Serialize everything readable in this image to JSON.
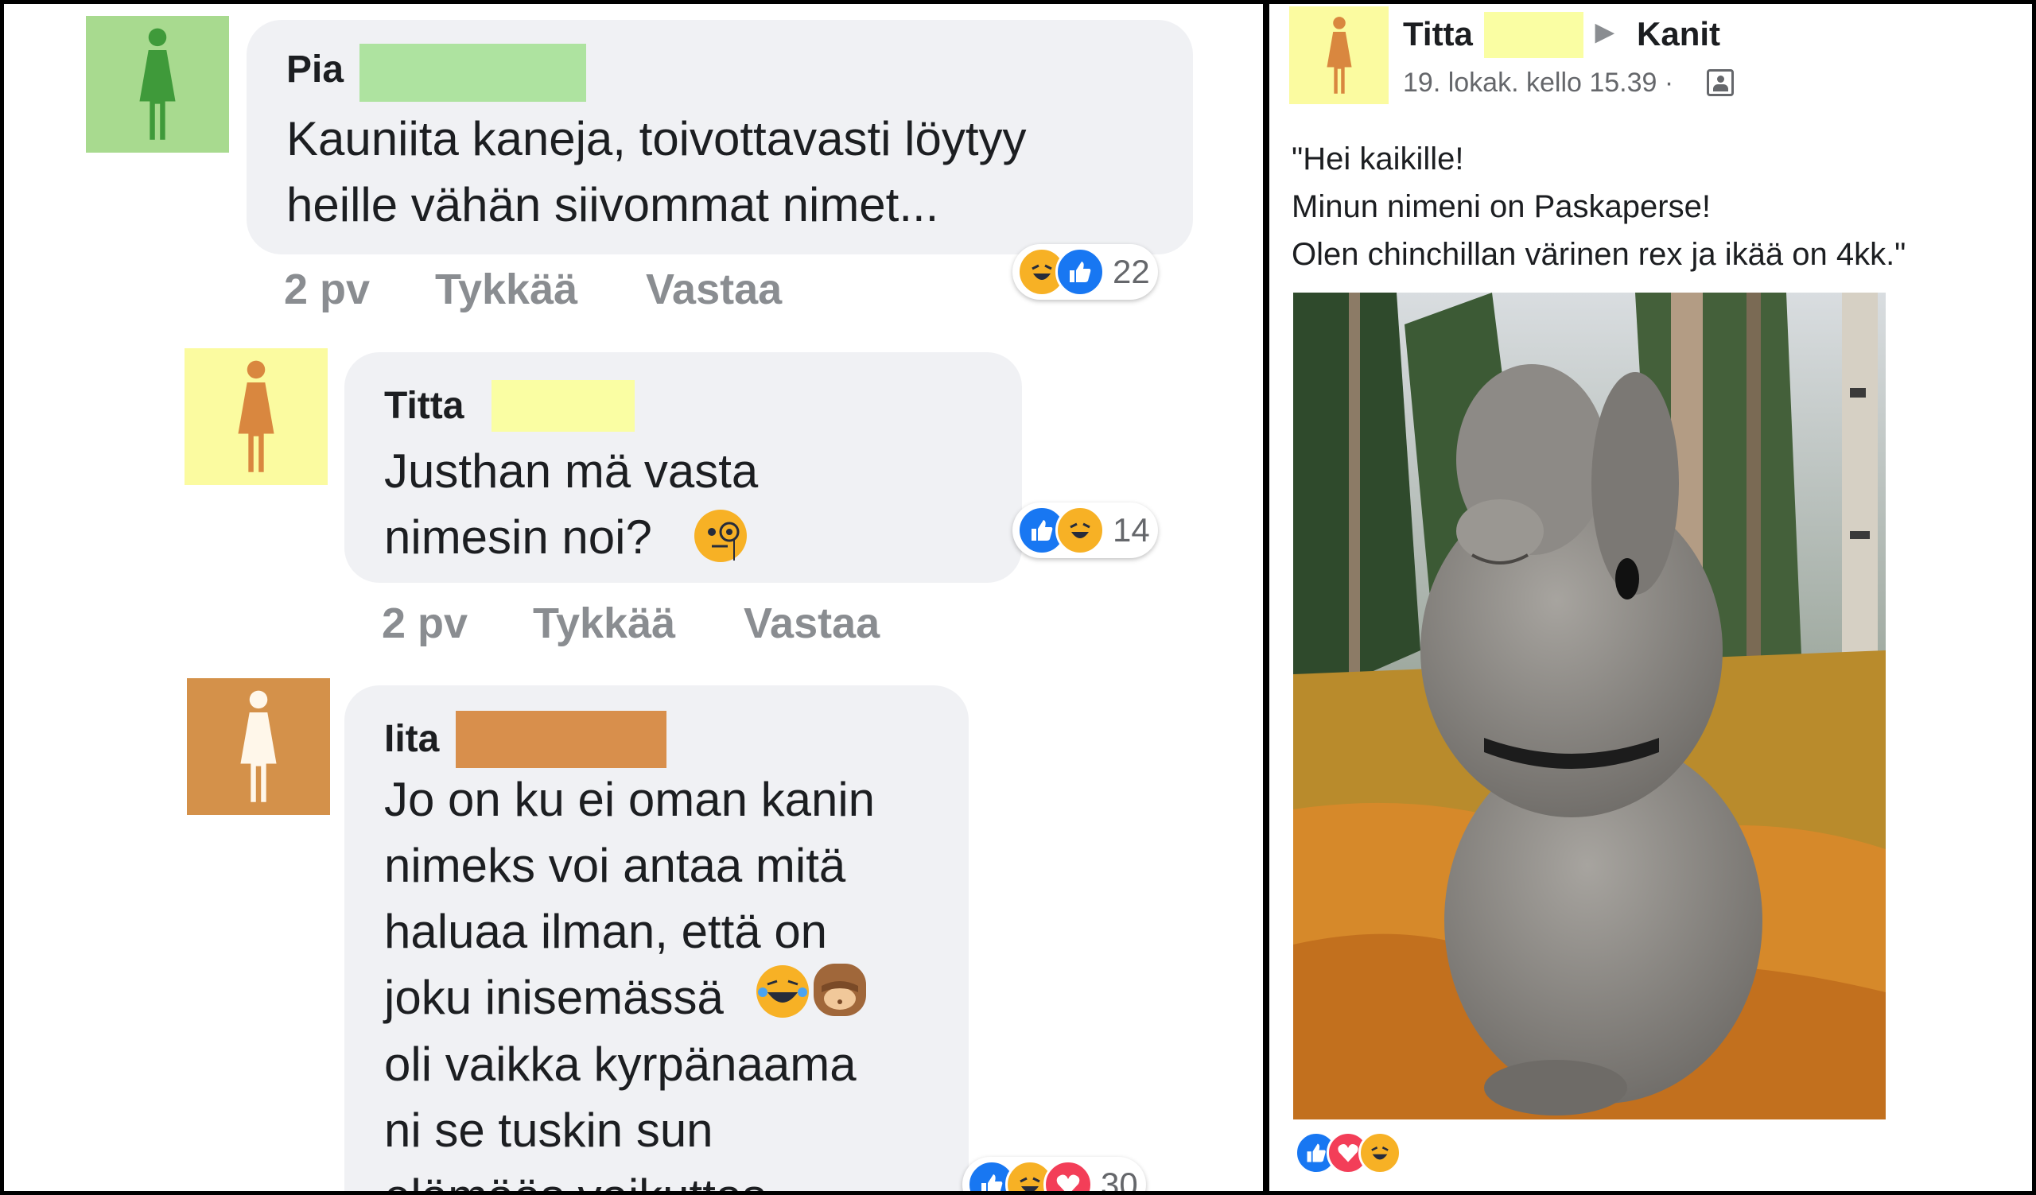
{
  "comments": [
    {
      "author": "Pia",
      "avatar_color": "#a8da8f",
      "redact_color": "#aee3a0",
      "text": "Kauniita kaneja, toivottavasti löytyy\nheille vähän siivommat nimet...",
      "time": "2 pv",
      "like_label": "Tykkää",
      "reply_label": "Vastaa",
      "reaction_icons": [
        "haha-icon",
        "like-icon"
      ],
      "reaction_count": "22"
    },
    {
      "author": "Titta",
      "avatar_color": "#fbfba0",
      "redact_color": "#fafea3",
      "text": "Justhan mä vasta\nnimesin noi?",
      "emoji": "monocle-face-icon",
      "time": "2 pv",
      "like_label": "Tykkää",
      "reply_label": "Vastaa",
      "reaction_icons": [
        "like-icon",
        "haha-icon"
      ],
      "reaction_count": "14"
    },
    {
      "author": "Iita",
      "avatar_color": "#d4914a",
      "redact_color": "#d88f4c",
      "text": "Jo on ku ei oman kanin\nnimeks voi antaa mitä\nhaluaa ilman, että on\njoku inisemässä",
      "emojis": [
        "tears-of-joy-icon",
        "see-no-evil-monkey-icon"
      ],
      "text2": "oli vaikka kyrpänaama\nni se tuskin sun",
      "text3": "elämääs vaikuttas",
      "reaction_icons": [
        "like-icon",
        "haha-icon",
        "love-icon"
      ],
      "reaction_count": "30"
    }
  ],
  "post": {
    "author": "Titta",
    "arrow": "▶",
    "group": "Kanit",
    "timestamp": "19. lokak. kello 15.39 ·",
    "privacy_icon": "group-privacy-icon",
    "text": "\"Hei kaikille!\nMinun nimeni on Paskaperse!\nOlen chinchillan värinen rex ja ikää on 4kk.\"",
    "reaction_icons": [
      "like-icon",
      "love-icon",
      "haha-icon"
    ]
  },
  "colors": {
    "like": "#1877f2",
    "haha": "#f7b125",
    "love": "#f33e58",
    "bubble": "#f0f1f4",
    "meta_text": "#8a8d91"
  }
}
